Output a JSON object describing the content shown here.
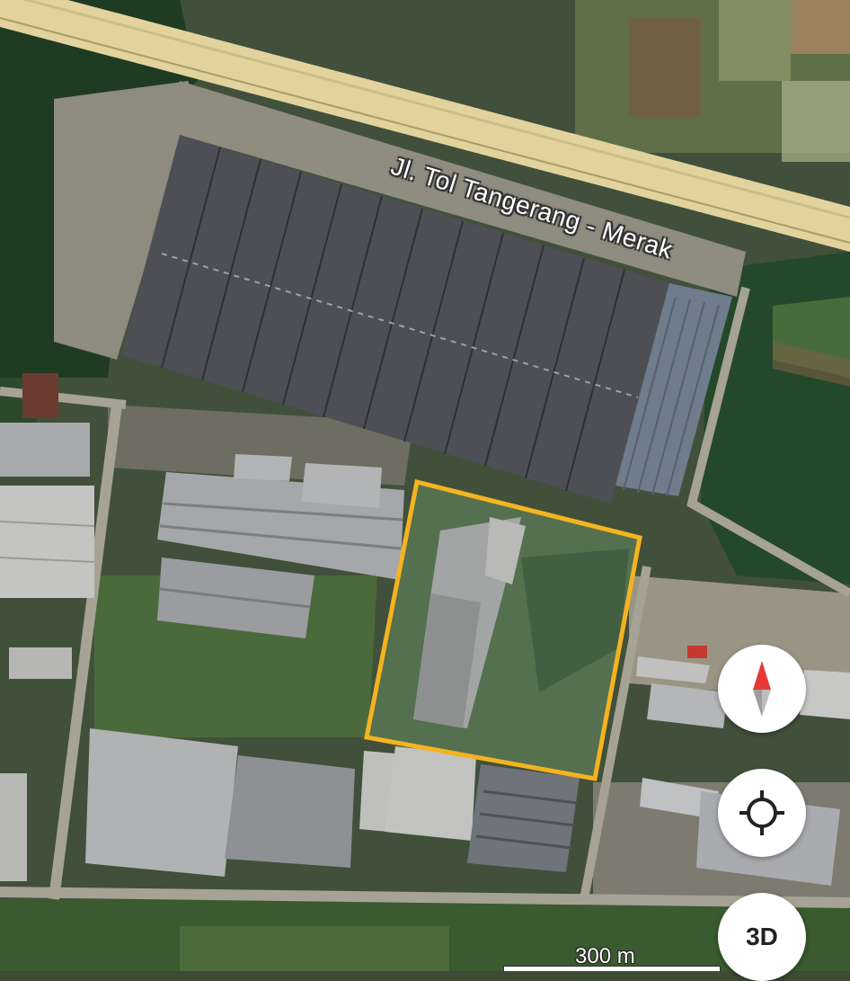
{
  "map": {
    "road_label": "Jl. Tol Tangerang - Merak",
    "scale_label": "300 m",
    "highlight_color": "#f5b320",
    "road_color": "#e2d39e"
  },
  "controls": {
    "compass_icon": "compass-icon",
    "my_location_icon": "crosshair-icon",
    "view_3d_label": "3D"
  }
}
